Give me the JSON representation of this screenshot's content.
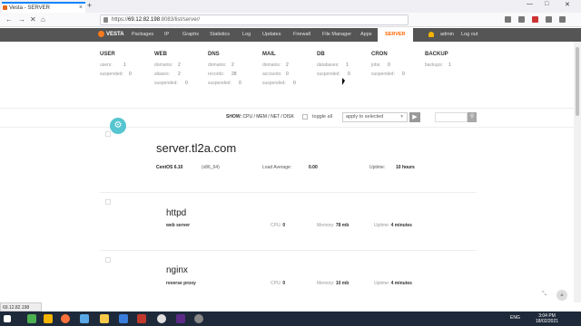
{
  "browser": {
    "tab_title": "Vesta - SERVER",
    "tab_close": "×",
    "new_tab": "+",
    "url_host": "69.12.82.198",
    "url_rest": ":8083/list/server/",
    "back": "←",
    "forward": "→",
    "reload": "✕",
    "home": "⌂",
    "minimize": "—",
    "maximize": "□",
    "close": "✕"
  },
  "menu": {
    "brand": "VESTA",
    "items": [
      "Packages",
      "IP",
      "Graphs",
      "Statistics",
      "Log",
      "Updates",
      "Firewall",
      "File Manager",
      "Apps",
      "SERVER"
    ],
    "user": "admin",
    "logout": "Log out"
  },
  "stats": {
    "user": {
      "title": "USER",
      "rows": [
        [
          "users:",
          "1"
        ],
        [
          "suspended:",
          "0"
        ]
      ]
    },
    "web": {
      "title": "WEB",
      "rows": [
        [
          "domains:",
          "2"
        ],
        [
          "aliases:",
          "2"
        ],
        [
          "suspended:",
          "0"
        ]
      ]
    },
    "dns": {
      "title": "DNS",
      "rows": [
        [
          "domains:",
          "2"
        ],
        [
          "records:",
          "28"
        ],
        [
          "suspended:",
          "0"
        ]
      ]
    },
    "mail": {
      "title": "MAIL",
      "rows": [
        [
          "domains:",
          "2"
        ],
        [
          "accounts:",
          "0"
        ],
        [
          "suspended:",
          "0"
        ]
      ]
    },
    "db": {
      "title": "DB",
      "rows": [
        [
          "databases:",
          "1"
        ],
        [
          "suspended:",
          "0"
        ]
      ]
    },
    "cron": {
      "title": "CRON",
      "rows": [
        [
          "jobs:",
          "0"
        ],
        [
          "suspended:",
          "0"
        ]
      ]
    },
    "backup": {
      "title": "BACKUP",
      "rows": [
        [
          "backups:",
          "1"
        ]
      ]
    }
  },
  "toolbar": {
    "add_icon": "⚙",
    "show_label": "SHOW:",
    "show_links": "CPU / MEM / NET / DISK",
    "toggle_all": "toggle all",
    "apply_selected": "apply to selected",
    "apply_go": "▶",
    "search_icon": "⚲"
  },
  "server": {
    "hostname": "server.tl2a.com",
    "os": "CentOS 6.10",
    "arch": "(x86_64)",
    "load_label": "Load Average:",
    "load_value": "0.00",
    "uptime_label": "Uptime:",
    "uptime_value": "10 hours"
  },
  "services": [
    {
      "name": "httpd",
      "desc": "web server",
      "cpu_label": "CPU:",
      "cpu": "0",
      "mem_label": "Memory:",
      "mem": "78 mb",
      "up_label": "Uptime:",
      "up": "4 minutes"
    },
    {
      "name": "nginx",
      "desc": "reverse proxy",
      "cpu_label": "CPU:",
      "cpu": "0",
      "mem_label": "Memory:",
      "mem": "10 mb",
      "up_label": "Uptime:",
      "up": "4 minutes"
    }
  ],
  "statusbar": "69.12.82.198",
  "taskbar": {
    "lang": "ENG",
    "time": "3:04 PM",
    "date": "18/02/2021"
  },
  "colors": {
    "accent": "#ff6701",
    "menu_bg": "#555555",
    "add_button": "#56c5d0",
    "taskbar": "#1e2a3a"
  }
}
